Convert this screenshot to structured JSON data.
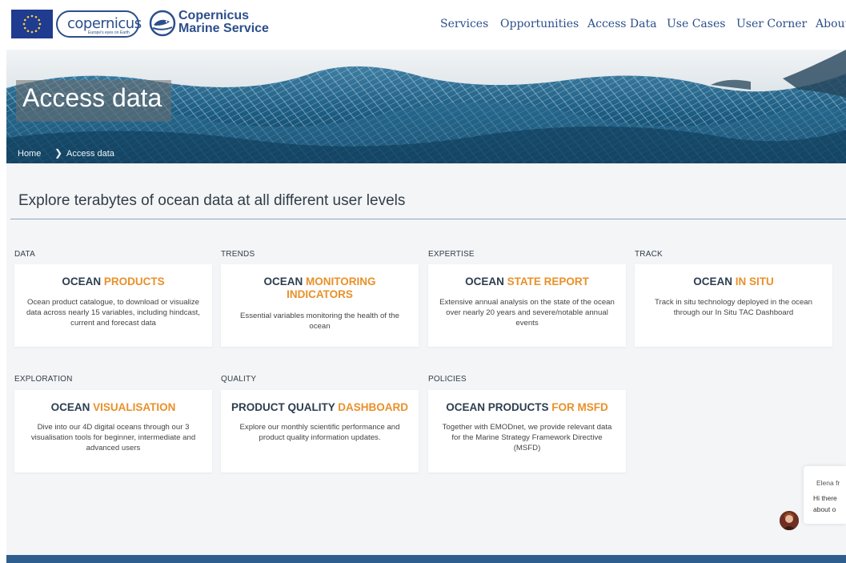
{
  "header": {
    "copernicus_word": "opernicus",
    "copernicus_c": "c",
    "copernicus_tagline": "Europe's eyes on Earth",
    "cms_line1": "Copernicus",
    "cms_line2": "Marine Service",
    "nav": [
      "Services",
      "Opportunities",
      "Access Data",
      "Use Cases",
      "User Corner",
      "About"
    ]
  },
  "hero": {
    "title": "Access data",
    "breadcrumb": [
      "Home",
      "Access data"
    ]
  },
  "intro": "Explore terabytes of ocean data at all different user levels",
  "cards": [
    {
      "category": "DATA",
      "title_a": "OCEAN ",
      "title_b": "PRODUCTS",
      "desc": "Ocean product catalogue, to download or visualize data across nearly 15 variables, including hindcast, current and forecast data"
    },
    {
      "category": "TRENDS",
      "title_a": "OCEAN ",
      "title_b": "MONITORING INDICATORS",
      "desc": "Essential variables monitoring the health of the ocean"
    },
    {
      "category": "EXPERTISE",
      "title_a": "OCEAN ",
      "title_b": "STATE REPORT",
      "desc": "Extensive annual analysis on the state of the ocean over nearly 20 years and severe/notable annual events"
    },
    {
      "category": "TRACK",
      "title_a": "OCEAN ",
      "title_b": "IN SITU",
      "desc": "Track in situ technology deployed in the ocean through our In Situ TAC Dashboard"
    },
    {
      "category": "EXPLORATION",
      "title_a": "OCEAN ",
      "title_b": "VISUALISATION",
      "desc": "Dive into our 4D digital oceans through our 3 visualisation tools for beginner, intermediate and advanced users"
    },
    {
      "category": "QUALITY",
      "title_a": "PRODUCT QUALITY ",
      "title_b": "DASHBOARD",
      "desc": "Explore our monthly scientific performance and product quality information updates."
    },
    {
      "category": "POLICIES",
      "title_a": "OCEAN PRODUCTS ",
      "title_b": "FOR MSFD",
      "desc": "Together with EMODnet, we provide relevant data for the Marine Strategy Framework Directive (MSFD)"
    }
  ],
  "chat": {
    "name": "Elena fr",
    "line1": "Hi there",
    "line2": "about o"
  },
  "colors": {
    "brand_blue": "#2c4f8c",
    "accent_orange": "#e9902a",
    "footer_blue": "#2e5e8e"
  }
}
